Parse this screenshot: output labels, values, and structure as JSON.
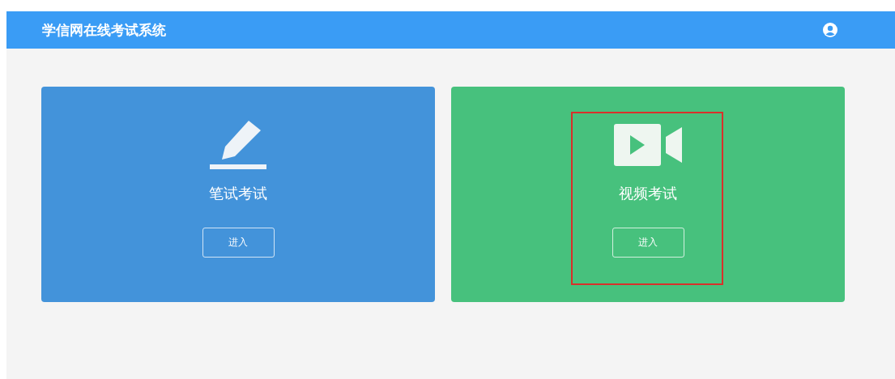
{
  "header": {
    "title": "学信网在线考试系统"
  },
  "cards": [
    {
      "kind": "written",
      "title": "笔试考试",
      "button": "进入",
      "color": "#4393da",
      "highlighted": false
    },
    {
      "kind": "video",
      "title": "视频考试",
      "button": "进入",
      "color": "#47c17d",
      "highlighted": true
    }
  ]
}
